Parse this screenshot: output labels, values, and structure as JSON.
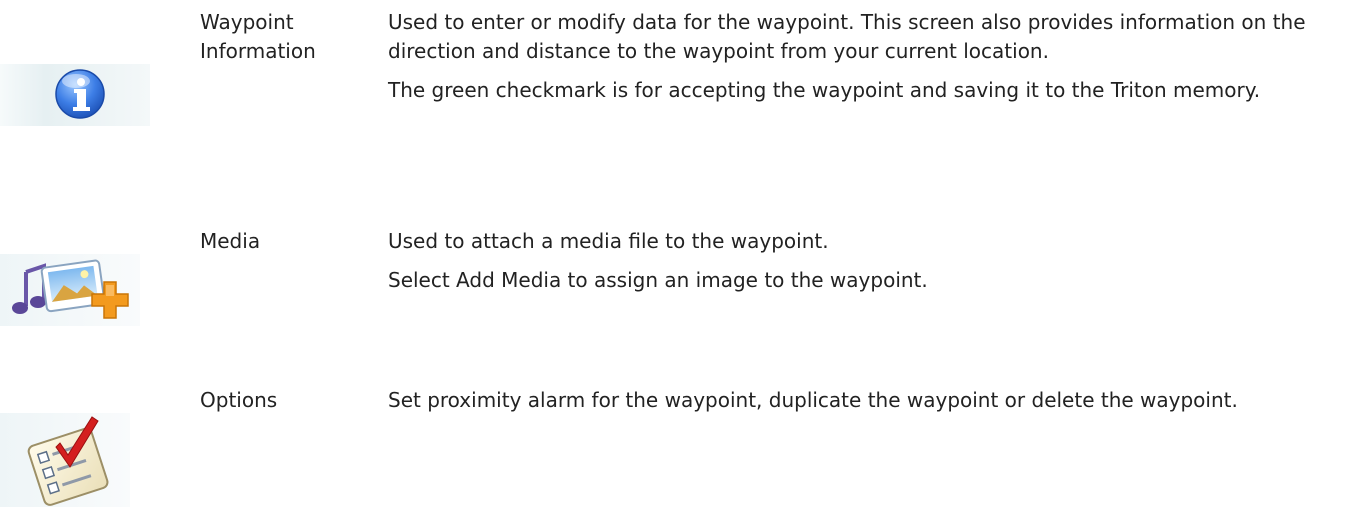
{
  "entries": [
    {
      "icon": "info-icon",
      "term_line1": "Waypoint",
      "term_line2": "Information",
      "paragraphs": [
        "Used to enter or modify data for the waypoint.  This screen also provides information on the direction and distance to the waypoint from your current location.",
        "The green checkmark is for accepting the waypoint and saving it to the Triton memory."
      ]
    },
    {
      "icon": "media-add-icon",
      "term_line1": "Media",
      "paragraphs": [
        "Used to attach a media file to the waypoint.",
        "Select Add Media to assign an image to the waypoint."
      ]
    },
    {
      "icon": "options-checklist-icon",
      "term_line1": "Options",
      "paragraphs": [
        "Set proximity alarm for the waypoint, duplicate the waypoint or delete the waypoint."
      ]
    }
  ],
  "colors": {
    "info_blue": "#2f6fd6",
    "plus_orange": "#f39a1e",
    "check_red": "#d41f1f"
  }
}
